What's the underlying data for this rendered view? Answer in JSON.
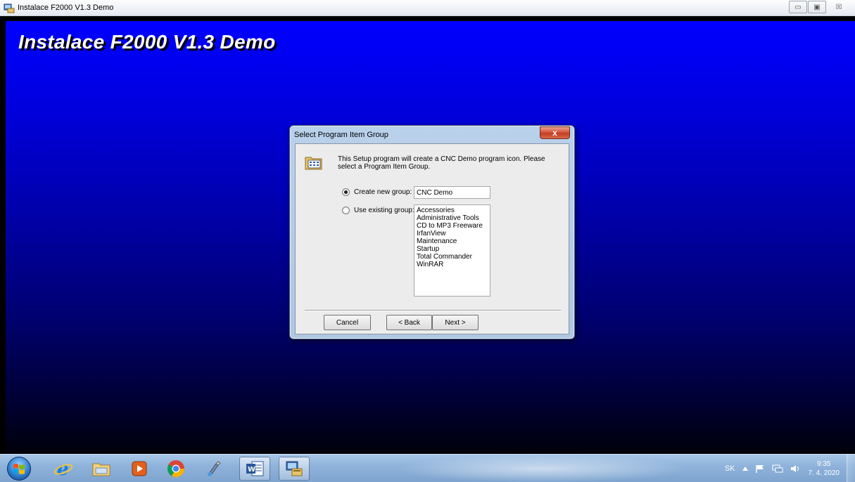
{
  "window": {
    "title": "Instalace F2000 V1.3 Demo",
    "controls": {
      "minimize": "▭",
      "maximize": "▣",
      "close": "☒"
    }
  },
  "installer": {
    "heading": "Instalace F2000 V1.3 Demo"
  },
  "dialog": {
    "title": "Select Program Item Group",
    "close_glyph": "x",
    "intro": "This Setup program will create a CNC Demo program icon. Please select a Program Item Group.",
    "create_new_group": {
      "label": "Create new group:",
      "checked": true,
      "value": "CNC Demo"
    },
    "use_existing_group": {
      "label": "Use existing group:",
      "checked": false
    },
    "existing_groups": [
      "Accessories",
      "Administrative Tools",
      "CD to MP3 Freeware",
      "IrfanView",
      "Maintenance",
      "Startup",
      "Total Commander",
      "WinRAR"
    ],
    "buttons": {
      "cancel": "Cancel",
      "back": "< Back",
      "next": "Next >"
    }
  },
  "taskbar": {
    "apps": [
      "start-orb",
      "internet-explorer",
      "file-explorer",
      "media-player",
      "chrome",
      "paint-tool",
      "word",
      "setup-program"
    ],
    "tray": {
      "language": "SK",
      "time": "9:35",
      "date": "7. 4. 2020"
    }
  },
  "colors": {
    "installer_top": "#0000ff",
    "installer_bottom": "#00000a",
    "dialog_frame": "#b9d1ea",
    "close_red": "#c13e22",
    "taskbar": "#8fb3db"
  }
}
